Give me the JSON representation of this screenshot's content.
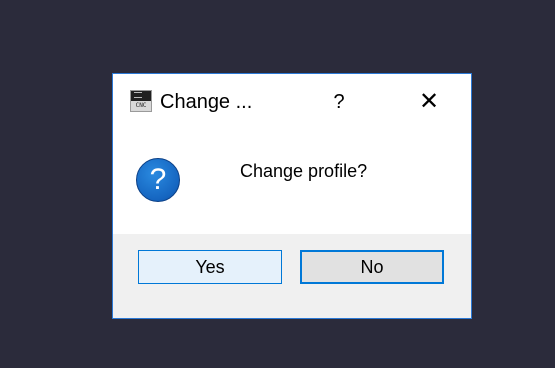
{
  "dialog": {
    "title": "Change ...",
    "help_label": "?",
    "close_label": "✕",
    "app_icon_text": "CNC",
    "message": "Change profile?",
    "icon_glyph": "?",
    "buttons": {
      "yes": "Yes",
      "no": "No"
    }
  },
  "icons": {
    "app": "app-logo-icon",
    "question": "question-icon",
    "close": "close-icon"
  },
  "colors": {
    "desktop_bg": "#2b2b3b",
    "dialog_border": "#2b79d6",
    "button_bar_bg": "#f0f0f0",
    "question_icon": "#1565c0",
    "focus_border": "#0078d7"
  }
}
